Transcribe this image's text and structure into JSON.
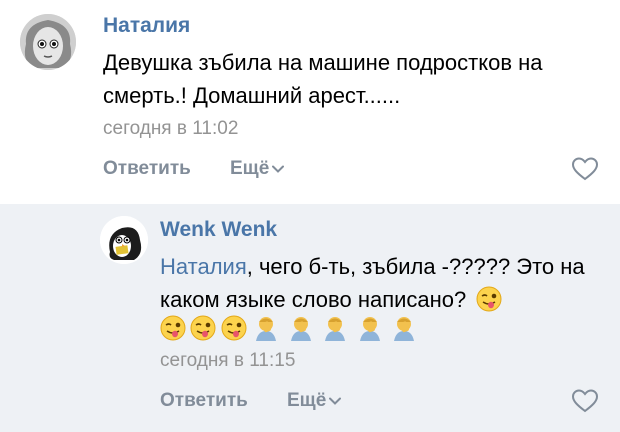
{
  "comments": [
    {
      "author": "Наталия",
      "text": "Девушка зъбила на машине подростков на смерть.! Домашний арест......",
      "time": "сегодня в 11:02",
      "reply_label": "Ответить",
      "more_label": "Ещё"
    },
    {
      "author": "Wenk Wenk",
      "mention": "Наталия",
      "text": ", чего б-ть, зъбила -????? Это на каком языке слово написано?",
      "emojis": [
        "tongue-wink-emoji",
        "tongue-wink-emoji",
        "tongue-wink-emoji",
        "tongue-wink-emoji",
        "man-facepalm-emoji",
        "man-facepalm-emoji",
        "man-facepalm-emoji",
        "man-facepalm-emoji",
        "man-facepalm-emoji"
      ],
      "time": "сегодня в 11:15",
      "reply_label": "Ответить",
      "more_label": "Ещё"
    }
  ],
  "colors": {
    "link": "#4a76a8",
    "meta": "#939393",
    "action": "#818c99",
    "reply_bg": "#eef1f5"
  }
}
